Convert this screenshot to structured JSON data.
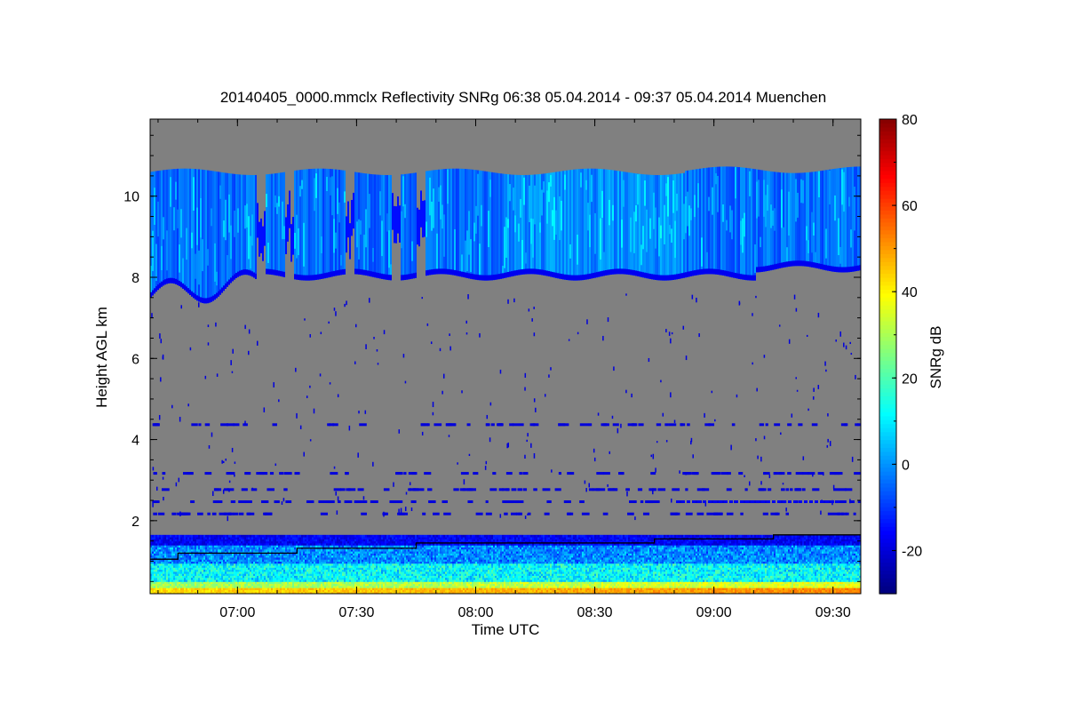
{
  "chart_data": {
    "type": "heatmap",
    "title": "20140405_0000.mmclx Reflectivity SNRg   06:38 05.04.2014 - 09:37 05.04.2014 Muenchen",
    "xlabel": "Time UTC",
    "ylabel": "Height AGL km",
    "colorbar_label": "SNRg dB",
    "x_range_utc": [
      "06:38",
      "09:37"
    ],
    "ylim_km": [
      0.2,
      11.9
    ],
    "x_ticks": [
      "07:00",
      "07:30",
      "08:00",
      "08:30",
      "09:00",
      "09:30"
    ],
    "y_ticks": [
      2,
      4,
      6,
      8,
      10
    ],
    "colorbar_range_db": [
      -30,
      80
    ],
    "colorbar_ticks": [
      -20,
      0,
      20,
      40,
      60,
      80
    ],
    "colormap": "jet",
    "background_color": "#808080",
    "features": {
      "cirrus_layer": {
        "base_km_start": 7.5,
        "base_km_main": 8.0,
        "top_km": 10.6,
        "snr_db": "-15 to 5"
      },
      "boundary_layer": {
        "top_km": 1.5,
        "snr_db": "0 to 50"
      },
      "boundary_layer_top_line": [
        {
          "time": "06:38",
          "height_km": 1.05
        },
        {
          "time": "06:45",
          "height_km": 1.2
        },
        {
          "time": "07:15",
          "height_km": 1.32
        },
        {
          "time": "07:45",
          "height_km": 1.45
        },
        {
          "time": "08:45",
          "height_km": 1.55
        },
        {
          "time": "09:15",
          "height_km": 1.65
        },
        {
          "time": "09:37",
          "height_km": 1.65
        }
      ]
    }
  }
}
